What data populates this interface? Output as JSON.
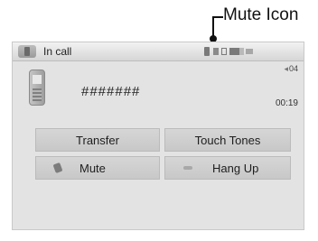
{
  "callout": {
    "label": "Mute Icon"
  },
  "status": {
    "title": "In call"
  },
  "call": {
    "number": "#######",
    "count": "04",
    "timer": "00:19"
  },
  "buttons": {
    "transfer": "Transfer",
    "touch_tones": "Touch Tones",
    "mute": "Mute",
    "hang_up": "Hang Up"
  },
  "icons": {
    "status_tab": "phone-tab-icon",
    "mute_status": "mute-icon",
    "phone": "mobile-phone-icon",
    "mute_button": "mute-icon",
    "hang_up": "hang-up-icon"
  }
}
